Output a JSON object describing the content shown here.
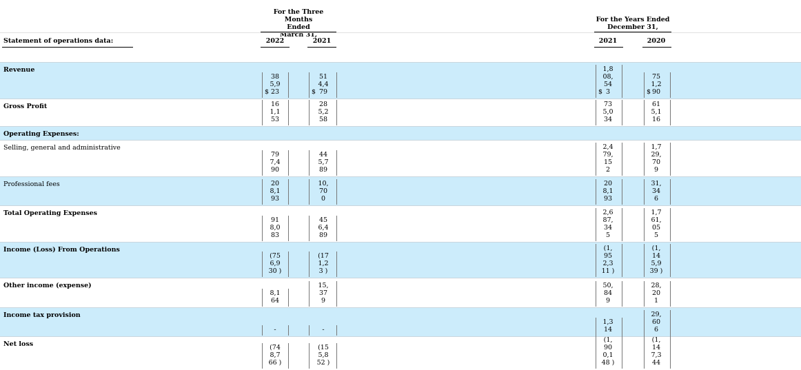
{
  "header": {
    "three_months": [
      "For the Three Months",
      "Ended",
      "March 31,"
    ],
    "years": [
      "For the Years Ended",
      "December 31,"
    ],
    "section_label": "Statement of operations data:",
    "columns": [
      "2022",
      "2021",
      "2021",
      "2020"
    ]
  },
  "rows": [
    {
      "label": "Revenue",
      "bold": true,
      "shaded": true,
      "dollar": true,
      "c1": [
        "38",
        "5,9",
        "23"
      ],
      "c2": [
        "51",
        "4,4",
        "79"
      ],
      "c3": [
        "1,8",
        "08,",
        "54",
        "3"
      ],
      "c4": [
        "75",
        "1,2",
        "90"
      ]
    },
    {
      "label": "Gross Profit",
      "bold": true,
      "shaded": false,
      "c1": [
        "16",
        "1,1",
        "53"
      ],
      "c2": [
        "28",
        "5,2",
        "58"
      ],
      "c3": [
        "73",
        "5,0",
        "34"
      ],
      "c4": [
        "61",
        "5,1",
        "16"
      ]
    },
    {
      "label": "Operating Expenses:",
      "bold": true,
      "shaded": true
    },
    {
      "label": "Selling, general and administrative",
      "bold": false,
      "shaded": false,
      "c1": [
        "79",
        "7,4",
        "90"
      ],
      "c2": [
        "44",
        "5,7",
        "89"
      ],
      "c3": [
        "2,4",
        "79,",
        "15",
        "2"
      ],
      "c4": [
        "1,7",
        "29,",
        "70",
        "9"
      ]
    },
    {
      "label": "Professional fees",
      "bold": false,
      "shaded": true,
      "c1": [
        "20",
        "8,1",
        "93"
      ],
      "c2": [
        "10,",
        "70",
        "0"
      ],
      "c3": [
        "20",
        "8,1",
        "93"
      ],
      "c4": [
        "31,",
        "34",
        "6"
      ]
    },
    {
      "label": "Total Operating Expenses",
      "bold": true,
      "shaded": false,
      "c1": [
        "91",
        "8,0",
        "83"
      ],
      "c2": [
        "45",
        "6,4",
        "89"
      ],
      "c3": [
        "2,6",
        "87,",
        "34",
        "5"
      ],
      "c4": [
        "1,7",
        "61,",
        "05",
        "5"
      ]
    },
    {
      "label": "Income (Loss) From Operations",
      "bold": true,
      "shaded": true,
      "c1": [
        "(75",
        "6,9",
        "30 )"
      ],
      "c2": [
        "(17",
        "1,2",
        "3 )"
      ],
      "c3": [
        "(1,",
        "95",
        "2,3",
        "11 )"
      ],
      "c4": [
        "(1,",
        "14",
        "5,9",
        "39 )"
      ]
    },
    {
      "label": "Other income (expense)",
      "bold": true,
      "shaded": false,
      "c1": [
        "8,1",
        "64"
      ],
      "c2": [
        "15,",
        "37",
        "9"
      ],
      "c3": [
        "50,",
        "84",
        "9"
      ],
      "c4": [
        "28,",
        "20",
        "1"
      ]
    },
    {
      "label": "Income tax provision",
      "bold": true,
      "shaded": true,
      "c1": [
        "-"
      ],
      "c2": [
        "-"
      ],
      "c3": [
        "1,3",
        "14"
      ],
      "c4": [
        "29,",
        "60",
        "6"
      ]
    },
    {
      "label": "Net loss",
      "bold": true,
      "shaded": false,
      "c1": [
        "(74",
        "8,7",
        "66 )"
      ],
      "c2": [
        "(15",
        "5,8",
        "52 )"
      ],
      "c3": [
        "(1,",
        "90",
        "0,1",
        "48 )"
      ],
      "c4": [
        "(1,",
        "14",
        "7,3",
        "44"
      ]
    }
  ],
  "currency_symbol": "$"
}
